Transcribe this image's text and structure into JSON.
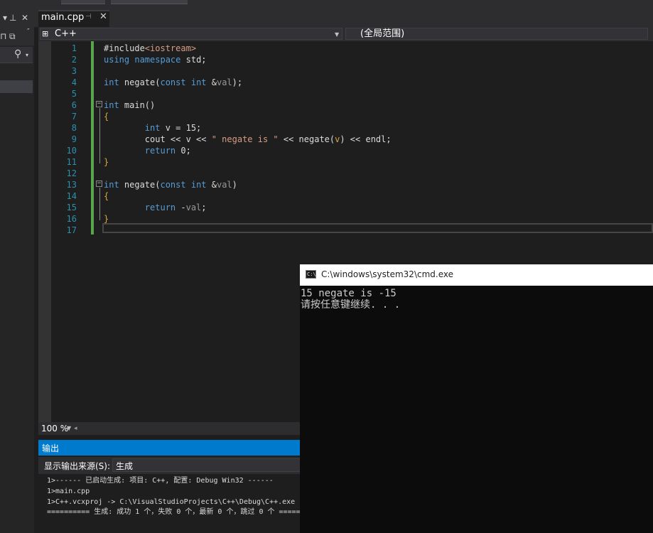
{
  "tab": {
    "label": "main.cpp",
    "pin_icon": "pin-icon",
    "close_icon": "close-icon"
  },
  "nav": {
    "scope_left": "C++",
    "scope_right": "(全局范围)"
  },
  "editor": {
    "line_numbers": [
      "1",
      "2",
      "3",
      "4",
      "5",
      "6",
      "7",
      "8",
      "9",
      "10",
      "11",
      "12",
      "13",
      "14",
      "15",
      "16",
      "17"
    ]
  },
  "zoom": {
    "value": "100 %"
  },
  "output": {
    "title": "输出",
    "source_label": "显示输出来源(S):",
    "source_value": "生成",
    "lines": [
      "1>------ 已启动生成: 项目: C++, 配置: Debug Win32 ------",
      "1>main.cpp",
      "1>C++.vcxproj -> C:\\VisualStudioProjects\\C++\\Debug\\C++.exe",
      "========== 生成: 成功 1 个，失败 0 个，最新 0 个，跳过 0 个 =========="
    ]
  },
  "console": {
    "title": "C:\\windows\\system32\\cmd.exe",
    "icon_text": "C:\\",
    "lines": [
      "15 negate is -15",
      "请按任意键继续. . ."
    ]
  },
  "colors": {
    "accent": "#007acc",
    "keyword": "#569cd6",
    "string": "#d69d85",
    "line_number": "#2b91af",
    "change_bar": "#57a64a"
  }
}
